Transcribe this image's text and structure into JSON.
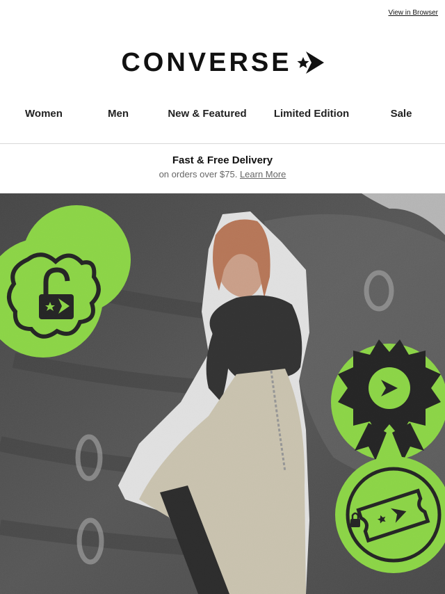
{
  "header": {
    "view_in_browser": "View in Browser",
    "brand": "CONVERSE"
  },
  "nav": {
    "items": [
      {
        "label": "Women"
      },
      {
        "label": "Men"
      },
      {
        "label": "New & Featured"
      },
      {
        "label": "Limited Edition"
      },
      {
        "label": "Sale"
      }
    ]
  },
  "promo": {
    "title": "Fast & Free Delivery",
    "text": "on orders over $75.",
    "link": "Learn More"
  },
  "hero": {
    "accent_color": "#8ee63a",
    "icons": [
      "lock-badge-icon",
      "award-ribbon-icon",
      "ticket-badge-icon"
    ]
  }
}
